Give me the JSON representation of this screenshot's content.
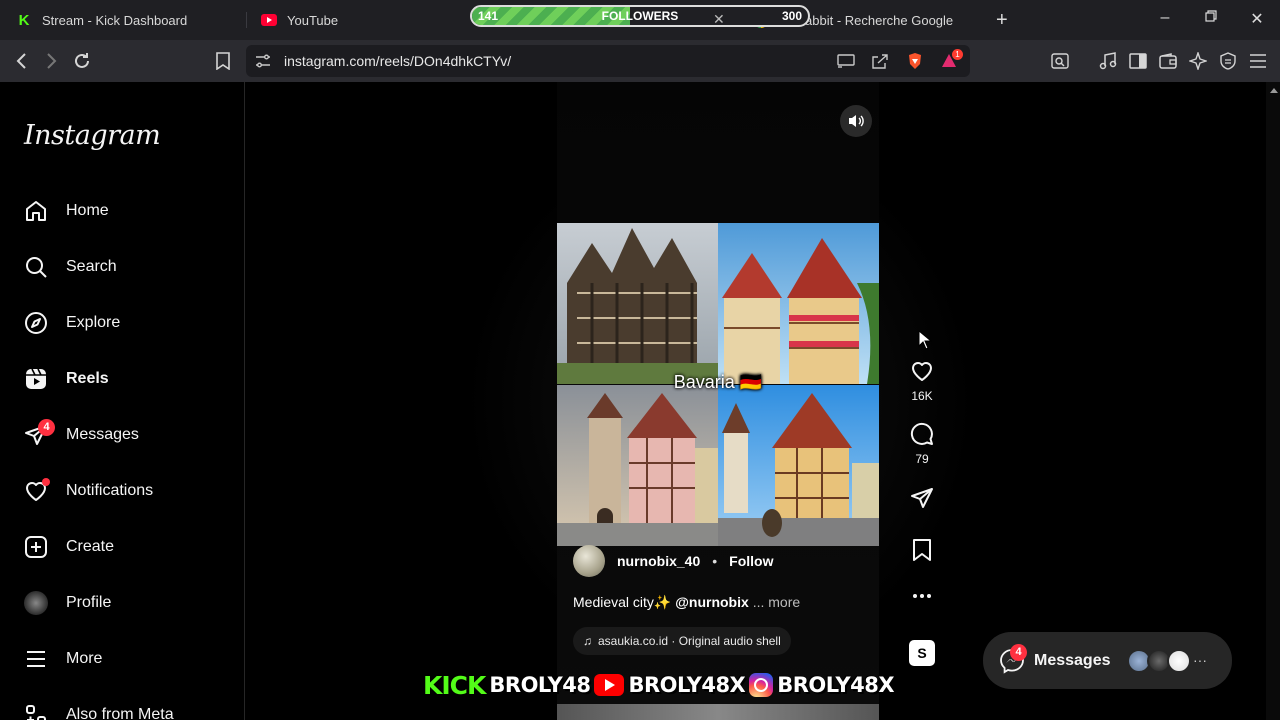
{
  "browser": {
    "tabs": [
      {
        "title": "Stream - Kick Dashboard",
        "icon": "kick-logo-icon"
      },
      {
        "title": "YouTube",
        "icon": "youtube-logo-icon"
      },
      {
        "title": "the rabbit - Recherche Google",
        "icon": "google-logo-icon"
      }
    ],
    "followers_goal": {
      "label": "FOLLOWERS",
      "start": "141",
      "end": "300",
      "progress": 0.47
    },
    "url": "instagram.com/reels/DOn4dhkCTYv/",
    "extension_badge": "1"
  },
  "sidebar": {
    "logo": "Instagram",
    "items": [
      {
        "label": "Home",
        "icon": "home-icon"
      },
      {
        "label": "Search",
        "icon": "search-icon"
      },
      {
        "label": "Explore",
        "icon": "compass-icon"
      },
      {
        "label": "Reels",
        "icon": "reels-icon",
        "active": true
      },
      {
        "label": "Messages",
        "icon": "messenger-icon",
        "badge": "4"
      },
      {
        "label": "Notifications",
        "icon": "heart-icon",
        "dot": true
      },
      {
        "label": "Create",
        "icon": "plus-square-icon"
      },
      {
        "label": "Profile",
        "icon": "profile-avatar"
      },
      {
        "label": "More",
        "icon": "hamburger-icon"
      },
      {
        "label": "Also from Meta",
        "icon": "meta-apps-icon"
      }
    ]
  },
  "reel": {
    "overlay_text": "Bavaria 🇩🇪",
    "author": "nurnobix_40",
    "follow_label": "Follow",
    "caption_text": "Medieval city✨ ",
    "caption_mention": "@nurnobix",
    "caption_more": "... more",
    "audio": "asaukia.co.id · Original audio   shell",
    "likes": "16K",
    "comments": "79",
    "audio_thumb": "S"
  },
  "messages_float": {
    "label": "Messages",
    "badge": "4"
  },
  "stream_banner": {
    "kick": "KICK",
    "kick_name": "BROLY48",
    "youtube_name": "BROLY48X",
    "instagram_name": "BROLY48X"
  },
  "colors": {
    "accent_red": "#ff3040",
    "kick_green": "#53fc18",
    "bg": "#000000"
  }
}
